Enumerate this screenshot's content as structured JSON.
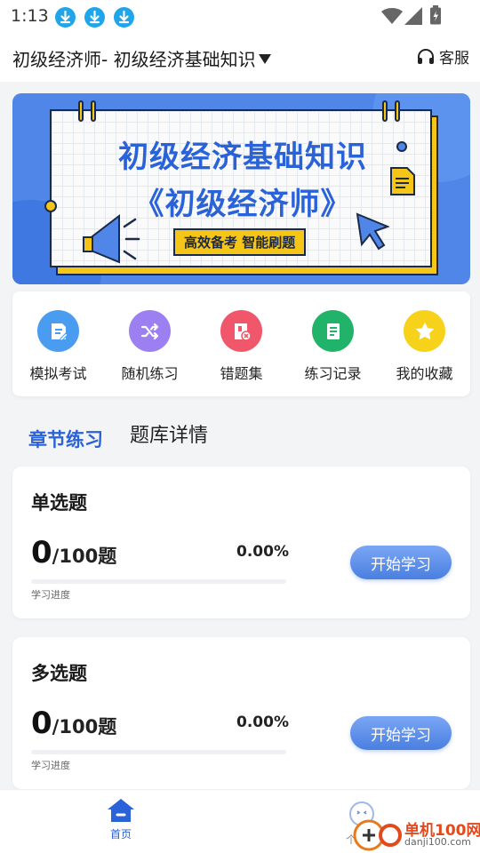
{
  "status_bar": {
    "time": "1:13"
  },
  "header": {
    "title": "初级经济师- 初级经济基础知识",
    "service_label": "客服"
  },
  "banner": {
    "line1": "初级经济基础知识",
    "line2": "《初级经济师》",
    "tag": "高效备考 智能刷题"
  },
  "quick_menu": [
    {
      "label": "模拟考试",
      "icon": "exam-doc-icon",
      "color": "#4a9cf0"
    },
    {
      "label": "随机练习",
      "icon": "shuffle-icon",
      "color": "#9c7ff0"
    },
    {
      "label": "错题集",
      "icon": "wrong-questions-icon",
      "color": "#f0576a"
    },
    {
      "label": "练习记录",
      "icon": "record-icon",
      "color": "#22b36a"
    },
    {
      "label": "我的收藏",
      "icon": "star-icon",
      "color": "#f7d21a"
    }
  ],
  "tabs": {
    "active": "章节练习",
    "inactive": "题库详情"
  },
  "cards": [
    {
      "title": "单选题",
      "done": "0",
      "sep": "/",
      "total": "100",
      "unit": "题",
      "percent": "0.00%",
      "progress": 0,
      "progress_label": "学习进度",
      "button": "开始学习"
    },
    {
      "title": "多选题",
      "done": "0",
      "sep": "/",
      "total": "100",
      "unit": "题",
      "percent": "0.00%",
      "progress": 0,
      "progress_label": "学习进度",
      "button": "开始学习"
    }
  ],
  "bottom_nav": {
    "home_label": "首页",
    "me_label": "个人中"
  },
  "watermark": {
    "line1": "单机100网",
    "line2": "danji100.com"
  },
  "colors": {
    "accent": "#2a62d8",
    "banner_bg": "#4f86e8",
    "yellow": "#f5c518"
  }
}
